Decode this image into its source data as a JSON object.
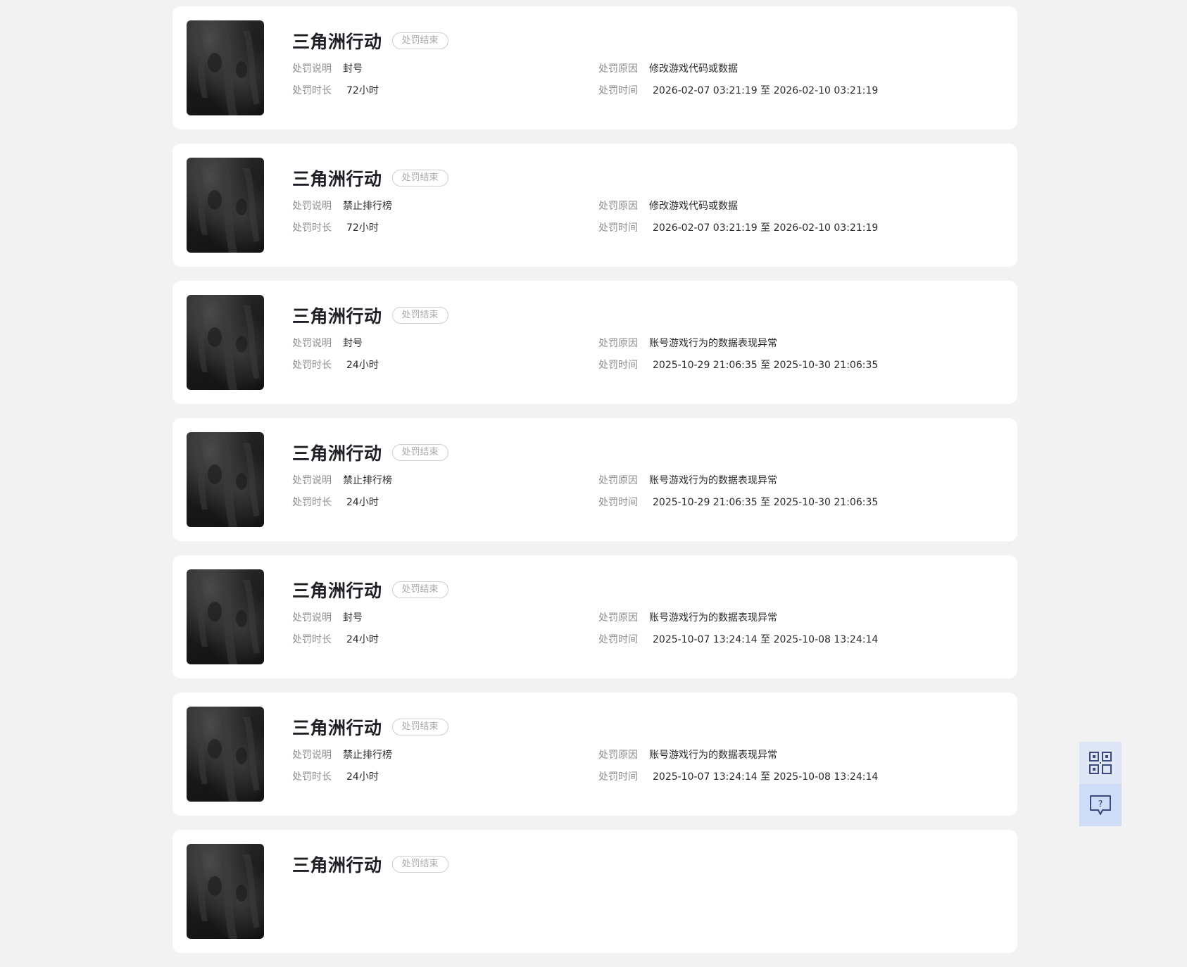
{
  "labels": {
    "desc": "处罚说明",
    "duration": "处罚时长",
    "reason": "处罚原因",
    "time": "处罚时间"
  },
  "records": [
    {
      "game": "三角洲行动",
      "status": "处罚结束",
      "desc": "封号",
      "duration": "72小时",
      "reason": "修改游戏代码或数据",
      "time": "2026-02-07 03:21:19 至 2026-02-10 03:21:19"
    },
    {
      "game": "三角洲行动",
      "status": "处罚结束",
      "desc": "禁止排行榜",
      "duration": "72小时",
      "reason": "修改游戏代码或数据",
      "time": "2026-02-07 03:21:19 至 2026-02-10 03:21:19"
    },
    {
      "game": "三角洲行动",
      "status": "处罚结束",
      "desc": "封号",
      "duration": "24小时",
      "reason": "账号游戏行为的数据表现异常",
      "time": "2025-10-29 21:06:35 至 2025-10-30 21:06:35"
    },
    {
      "game": "三角洲行动",
      "status": "处罚结束",
      "desc": "禁止排行榜",
      "duration": "24小时",
      "reason": "账号游戏行为的数据表现异常",
      "time": "2025-10-29 21:06:35 至 2025-10-30 21:06:35"
    },
    {
      "game": "三角洲行动",
      "status": "处罚结束",
      "desc": "封号",
      "duration": "24小时",
      "reason": "账号游戏行为的数据表现异常",
      "time": "2025-10-07 13:24:14 至 2025-10-08 13:24:14"
    },
    {
      "game": "三角洲行动",
      "status": "处罚结束",
      "desc": "禁止排行榜",
      "duration": "24小时",
      "reason": "账号游戏行为的数据表现异常",
      "time": "2025-10-07 13:24:14 至 2025-10-08 13:24:14"
    },
    {
      "game": "三角洲行动",
      "status": "处罚结束"
    }
  ],
  "side_tools": {
    "qr_icon": "qr-code-icon",
    "help_icon": "feedback-question-icon",
    "accent": "#3b4a7a"
  }
}
